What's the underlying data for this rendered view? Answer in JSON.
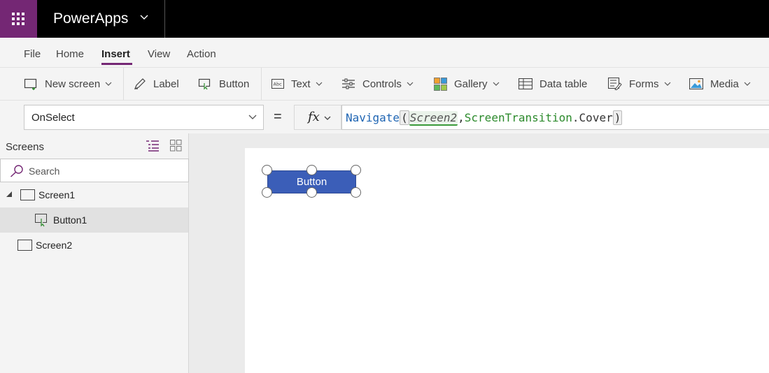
{
  "app": {
    "name": "PowerApps"
  },
  "menu": {
    "tabs": [
      "File",
      "Home",
      "Insert",
      "View",
      "Action"
    ],
    "active": "Insert"
  },
  "ribbon": {
    "new_screen": "New screen",
    "label": "Label",
    "button": "Button",
    "text": "Text",
    "controls": "Controls",
    "gallery": "Gallery",
    "data_table": "Data table",
    "forms": "Forms",
    "media": "Media"
  },
  "formula_bar": {
    "property": "OnSelect",
    "equals": "=",
    "fx": "fx",
    "formula": {
      "function": "Navigate",
      "open_paren": "(",
      "arg1": "Screen2",
      "comma": ",",
      "arg2": "ScreenTransition",
      "dot": ".",
      "arg3": "Cover",
      "close_paren": ")"
    }
  },
  "screens_panel": {
    "title": "Screens",
    "search_placeholder": "Search",
    "tree": [
      {
        "label": "Screen1",
        "level": 0,
        "expanded": true
      },
      {
        "label": "Button1",
        "level": 1,
        "selected": true
      },
      {
        "label": "Screen2",
        "level": 0
      }
    ]
  },
  "canvas": {
    "button_text": "Button"
  },
  "colors": {
    "brand": "#742774",
    "topbar": "#000000",
    "button_fill": "#3b5eb8",
    "formula_function": "#1f65b3",
    "formula_enum": "#2c8a2c"
  }
}
